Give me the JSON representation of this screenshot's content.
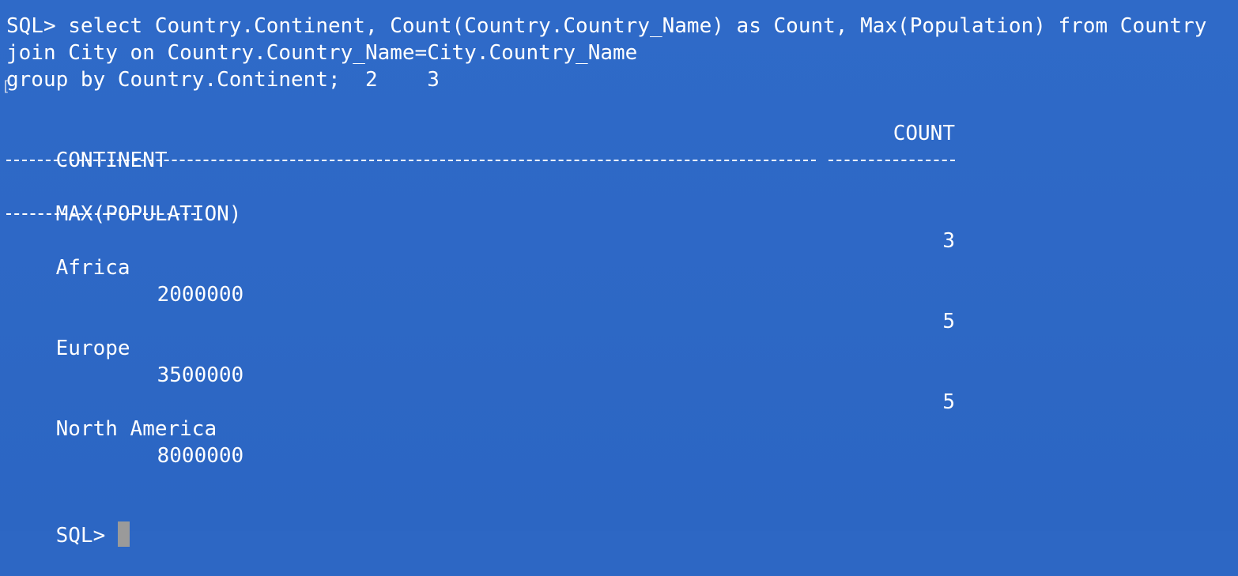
{
  "query": {
    "line1": "SQL> select Country.Continent, Count(Country.Country_Name) as Count, Max(Population) from Country",
    "line2": "join City on Country.Country_Name=City.Country_Name",
    "line3": "group by Country.Continent;  2    3",
    "bracket": "["
  },
  "table": {
    "headers": {
      "continent": "CONTINENT",
      "count": "COUNT",
      "max_population": "MAX(POPULATION)"
    },
    "rows": [
      {
        "continent": "Africa",
        "count": "3",
        "max_population": "2000000"
      },
      {
        "continent": "Europe",
        "count": "5",
        "max_population": "3500000"
      },
      {
        "continent": "North America",
        "count": "5",
        "max_population": "8000000"
      }
    ]
  },
  "prompt": {
    "label": "SQL>"
  },
  "colors": {
    "background": "#2d67c4",
    "text": "#ffffff",
    "cursor": "#9a9a9a"
  }
}
